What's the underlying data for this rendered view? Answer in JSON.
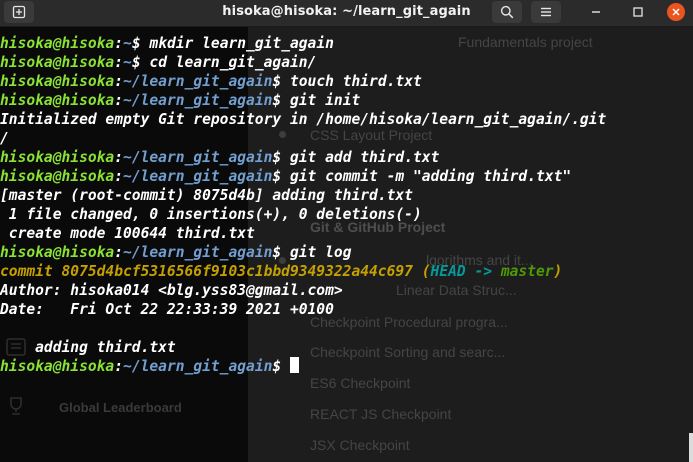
{
  "window": {
    "title": "hisoka@hisoka: ~/learn_git_again",
    "icons": {
      "new_tab": "new-tab-icon",
      "search": "search-icon",
      "menu": "hamburger-menu-icon",
      "minimize": "minimize-icon",
      "maximize": "maximize-icon",
      "close": "close-icon"
    }
  },
  "colors": {
    "user_host": "#8ae234",
    "path": "#729fcf",
    "commit_hash": "#c4a000",
    "head": "#06989a",
    "branch": "#4e9a06",
    "close_button": "#e95420"
  },
  "background_page": {
    "items": [
      "Fundamentals project",
      "CSS Layout Project",
      "Git & GitHub Project",
      "lgorithms and it...",
      "Linear Data Struc...",
      "Checkpoint Procedural progra...",
      "Checkpoint Sorting and searc...",
      "ES6 Checkpoint",
      "REACT JS Checkpoint",
      "JSX Checkpoint"
    ],
    "sidebar_label": "Global Leaderboard"
  },
  "terminal": {
    "user_host": "hisoka@hisoka",
    "home_path": "~",
    "repo_path": "~/learn_git_again",
    "lines": [
      {
        "type": "prompt",
        "path": "~",
        "cmd": "mkdir learn_git_again"
      },
      {
        "type": "prompt",
        "path": "~",
        "cmd": "cd learn_git_again/"
      },
      {
        "type": "prompt",
        "path": "~/learn_git_again",
        "cmd": "touch third.txt"
      },
      {
        "type": "prompt",
        "path": "~/learn_git_again",
        "cmd": "git init"
      },
      {
        "type": "output",
        "text": "Initialized empty Git repository in /home/hisoka/learn_git_again/.git"
      },
      {
        "type": "output",
        "text": "/"
      },
      {
        "type": "prompt",
        "path": "~/learn_git_again",
        "cmd": "git add third.txt"
      },
      {
        "type": "prompt",
        "path": "~/learn_git_again",
        "cmd": "git commit -m \"adding third.txt\""
      },
      {
        "type": "output",
        "text": "[master (root-commit) 8075d4b] adding third.txt"
      },
      {
        "type": "output",
        "text": " 1 file changed, 0 insertions(+), 0 deletions(-)"
      },
      {
        "type": "output",
        "text": " create mode 100644 third.txt"
      },
      {
        "type": "prompt",
        "path": "~/learn_git_again",
        "cmd": "git log"
      },
      {
        "type": "commit",
        "label": "commit 8075d4bcf5316566f9103c1bbd9349322a44c697",
        "open": " (",
        "head": "HEAD -> ",
        "branch": "master",
        "close": ")"
      },
      {
        "type": "output",
        "text": "Author: hisoka014 <blg.yss83@gmail.com>"
      },
      {
        "type": "output",
        "text": "Date:   Fri Oct 22 22:33:39 2021 +0100"
      },
      {
        "type": "output",
        "text": ""
      },
      {
        "type": "output",
        "text": "    adding third.txt"
      },
      {
        "type": "prompt",
        "path": "~/learn_git_again",
        "cmd": "",
        "cursor": true
      }
    ]
  }
}
